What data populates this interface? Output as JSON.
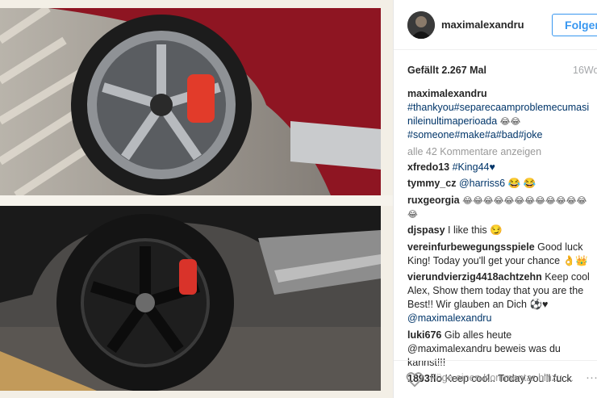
{
  "header": {
    "username": "maximalexandru",
    "follow_label": "Folgen"
  },
  "stats": {
    "likes": "Gefällt 2.267 Mal",
    "time": "16Wo"
  },
  "caption": {
    "user": "maximalexandru",
    "tags": "#thankyou#separecaamproblemecumasinileinultimaperioada",
    "emoji_a": "😂😂",
    "tags2": "#someone#make#a#bad#joke"
  },
  "more_comments": "alle 42 Kommentare anzeigen",
  "comments": [
    {
      "user": "xfredo13",
      "text": "#King44♥"
    },
    {
      "user": "tymmy_cz",
      "text": "@harriss6 😂 😂"
    },
    {
      "user": "ruxgeorgia",
      "text": "😂😂😂😂😂😂😂😂😂😂😂😂😂"
    },
    {
      "user": "djspasy",
      "text": "I like this 😏"
    },
    {
      "user": "vereinfurbewegungsspiele",
      "text": "Good luck King! Today you'll get your chance 👌👑"
    },
    {
      "user": "vierundvierzig4418achtzehn",
      "text": "Keep cool Alex, Show them today that you are the Best!! Wir glauben an Dich ⚽♥"
    },
    {
      "user": "@maximalexandru",
      "text": ""
    },
    {
      "user": "luki676",
      "text": "Gib alles heute @maximalexandru beweis was du kannst!!!"
    },
    {
      "user": "1893flo",
      "text": "Keep cool.. Today you'll fuck"
    }
  ],
  "footer": {
    "add_comment_placeholder": "Füge einen Kommentar hinzu ...",
    "menu": "···"
  },
  "colors": {
    "follow_blue": "#3897f0",
    "hashtag": "#003569",
    "muted": "#999999"
  }
}
